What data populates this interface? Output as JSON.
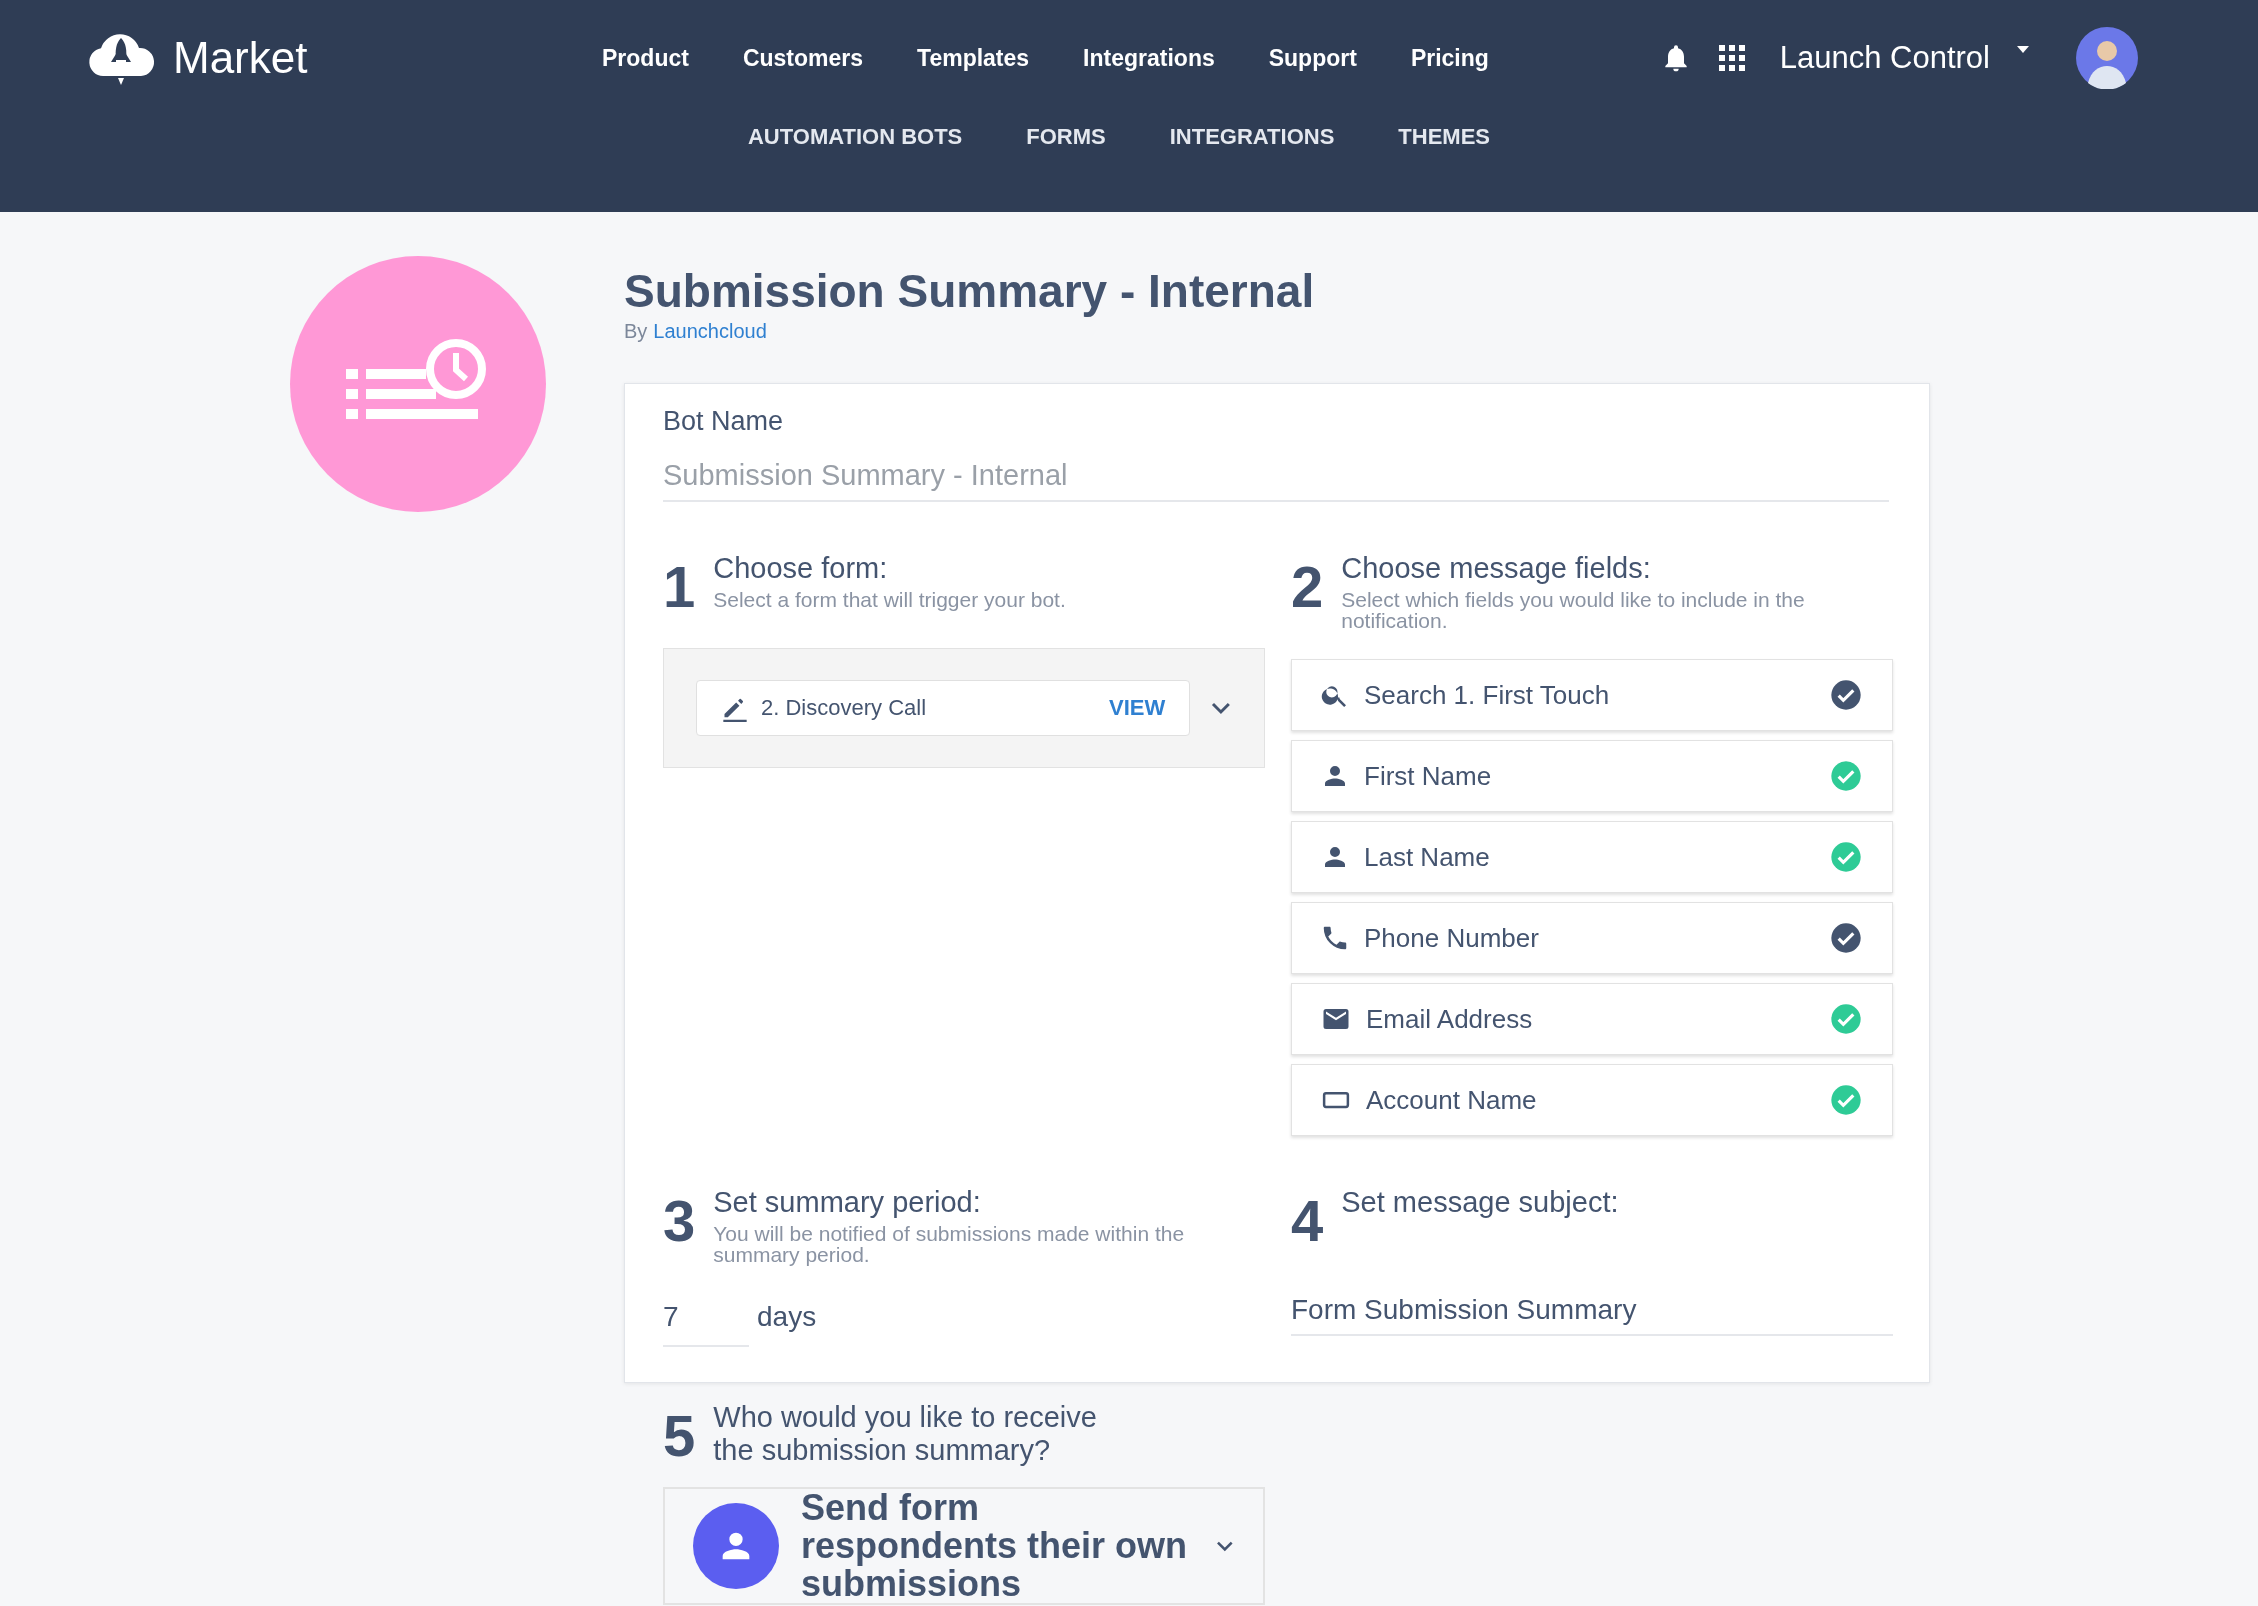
{
  "header": {
    "logo": "Market",
    "nav": [
      "Product",
      "Customers",
      "Templates",
      "Integrations",
      "Support",
      "Pricing"
    ],
    "account": "Launch Control"
  },
  "subnav": [
    "AUTOMATION BOTS",
    "FORMS",
    "INTEGRATIONS",
    "THEMES"
  ],
  "bot": {
    "title": "Submission Summary - Internal",
    "by": "By",
    "author": "Launchcloud"
  },
  "bot_name": {
    "label": "Bot Name",
    "value": "Submission Summary - Internal"
  },
  "step_1": {
    "number": "1",
    "title": "Choose form:",
    "subtitle": "Select a form that will trigger your bot.",
    "form": "2. Discovery Call",
    "action": "VIEW"
  },
  "step_2": {
    "number": "2",
    "title": "Choose message fields:",
    "subtitle": "Select which fields you would like to include in the notification.",
    "fields": [
      {
        "kind": "search",
        "label": "Search 1. First Touch",
        "color": "#44546f"
      },
      {
        "kind": "person",
        "label": "First Name",
        "color": "#2ecb96"
      },
      {
        "kind": "person",
        "label": "Last Name",
        "color": "#2ecb96"
      },
      {
        "kind": "phone",
        "label": "Phone Number",
        "color": "#44546f"
      },
      {
        "kind": "email",
        "label": "Email Address",
        "color": "#2ecb96"
      },
      {
        "kind": "account",
        "label": "Account Name",
        "color": "#2ecb96"
      }
    ]
  },
  "step_3": {
    "number": "3",
    "title": "Set summary period:",
    "subtitle": "You will be notified of submissions made within the summary period.",
    "value": "7",
    "unit": "days"
  },
  "step_4": {
    "number": "4",
    "title": "Set message subject:",
    "value": "Form Submission Summary"
  },
  "step_5": {
    "number": "5",
    "title": "Who would you like to receive the submission summary?",
    "recipient": "Send form respondents their own submissions"
  }
}
